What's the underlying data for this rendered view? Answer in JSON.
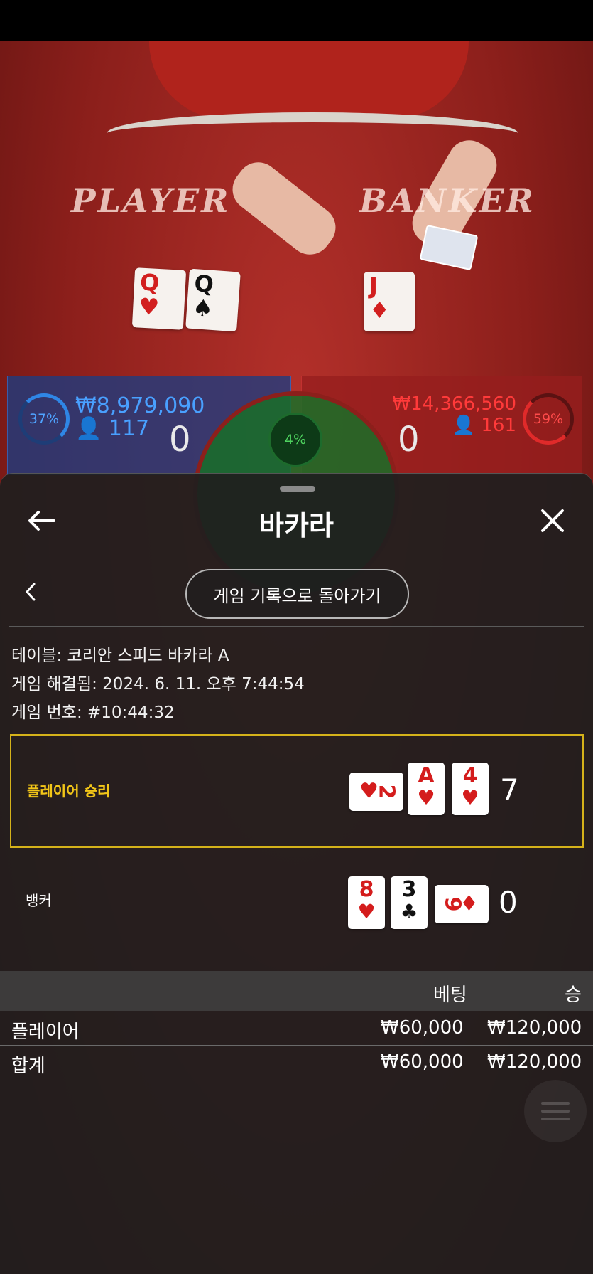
{
  "table": {
    "player_word": "PLAYER",
    "banker_word": "BANKER",
    "player_cards": [
      {
        "rank": "Q",
        "suit": "♥",
        "color": "red"
      },
      {
        "rank": "Q",
        "suit": "♠",
        "color": "black"
      }
    ],
    "banker_cards": [
      {
        "rank": "J",
        "suit": "♦",
        "color": "red"
      }
    ]
  },
  "stats": {
    "player_percent": "37%",
    "player_amount": "₩8,979,090",
    "player_count": "117",
    "player_score": "0",
    "tie_percent": "4%",
    "banker_percent": "59%",
    "banker_amount": "₩14,366,560",
    "banker_count": "161",
    "banker_score": "0"
  },
  "sheet": {
    "title": "바카라",
    "back_history_label": "게임 기록으로 돌아가기",
    "table_line": "테이블: 코리안 스피드 바카라 A",
    "resolved_line": "게임 해결됨: 2024. 6. 11. 오후 7:44:54",
    "game_no_line": "게임 번호: #10:44:32",
    "player_hand": {
      "label": "플레이어 승리",
      "score": "7",
      "cards": [
        {
          "rank": "2",
          "suit": "♥",
          "color": "red",
          "side": true
        },
        {
          "rank": "A",
          "suit": "♥",
          "color": "red",
          "side": false
        },
        {
          "rank": "4",
          "suit": "♥",
          "color": "red",
          "side": false
        }
      ]
    },
    "banker_hand": {
      "label": "뱅커",
      "score": "0",
      "cards": [
        {
          "rank": "8",
          "suit": "♥",
          "color": "red",
          "side": false
        },
        {
          "rank": "3",
          "suit": "♣",
          "color": "black",
          "side": false
        },
        {
          "rank": "9",
          "suit": "♦",
          "color": "red",
          "side": true
        }
      ]
    },
    "bets": {
      "col_bet": "베팅",
      "col_win": "승",
      "rows": [
        {
          "name": "플레이어",
          "bet": "₩60,000",
          "win": "₩120,000"
        },
        {
          "name": "합계",
          "bet": "₩60,000",
          "win": "₩120,000"
        }
      ]
    }
  },
  "colors": {
    "win_highlight": "#f2c618",
    "player_blue": "#49a0ff",
    "banker_red": "#ff3a3a",
    "tie_green": "#4ed35f"
  }
}
